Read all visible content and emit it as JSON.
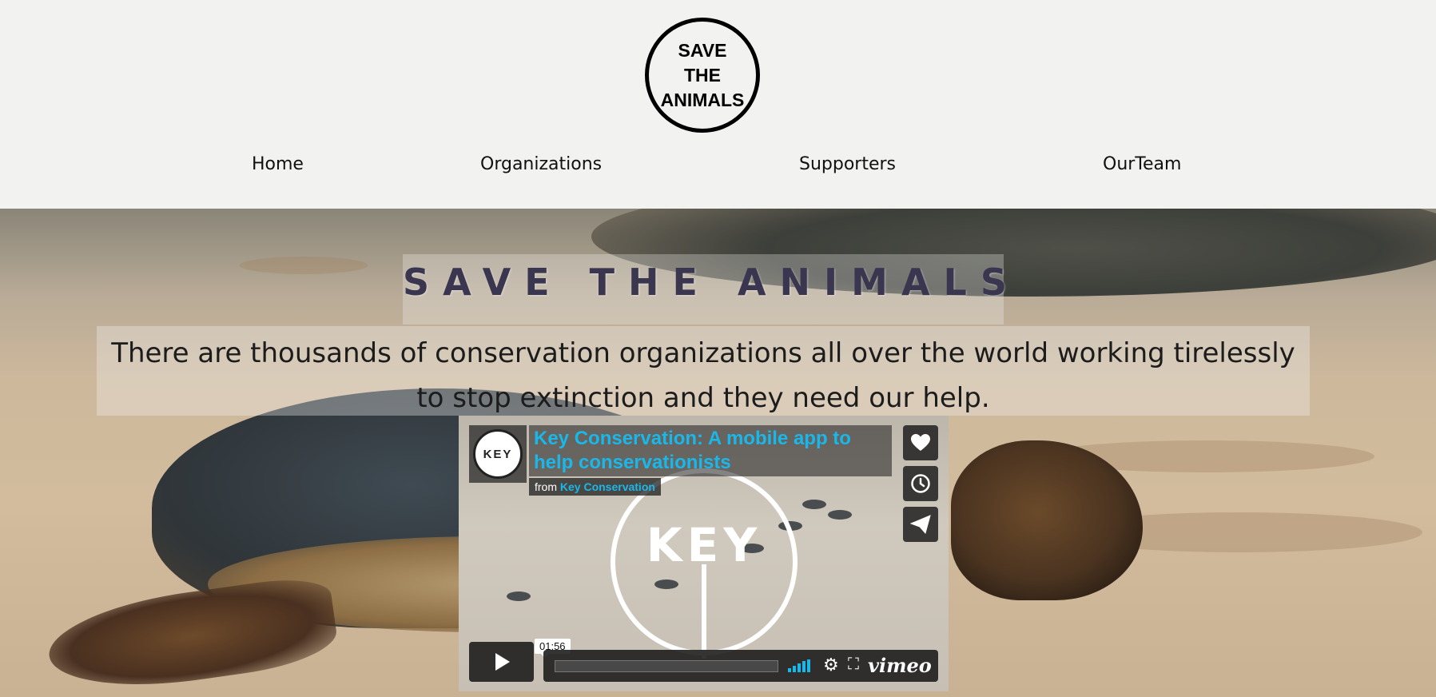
{
  "logo": {
    "lines": [
      "SAVE",
      "THE",
      "ANIMALS"
    ]
  },
  "nav": {
    "home": "Home",
    "organizations": "Organizations",
    "supporters": "Supporters",
    "team": "OurTeam"
  },
  "hero": {
    "title": "SAVE THE ANIMALS",
    "tagline": "There are thousands of conservation organizations all over the world working tirelessly to stop extinction and they need our help."
  },
  "video": {
    "avatar_text": "KEY",
    "title": "Key Conservation: A mobile app to help conservationists",
    "from_label": "from",
    "from_author": "Key Conservation",
    "watermark": "KEY",
    "time": "01:56",
    "brand": "vimeo",
    "icons": {
      "like": "heart-icon",
      "later": "clock-icon",
      "share": "paper-plane-icon",
      "play": "play-icon",
      "volume": "volume-icon",
      "settings": "gear-icon",
      "fullscreen": "fullscreen-icon"
    }
  },
  "colors": {
    "vimeo_accent": "#1ab7ea",
    "header_bg": "#f2f2f0",
    "title": "#3a3650"
  }
}
